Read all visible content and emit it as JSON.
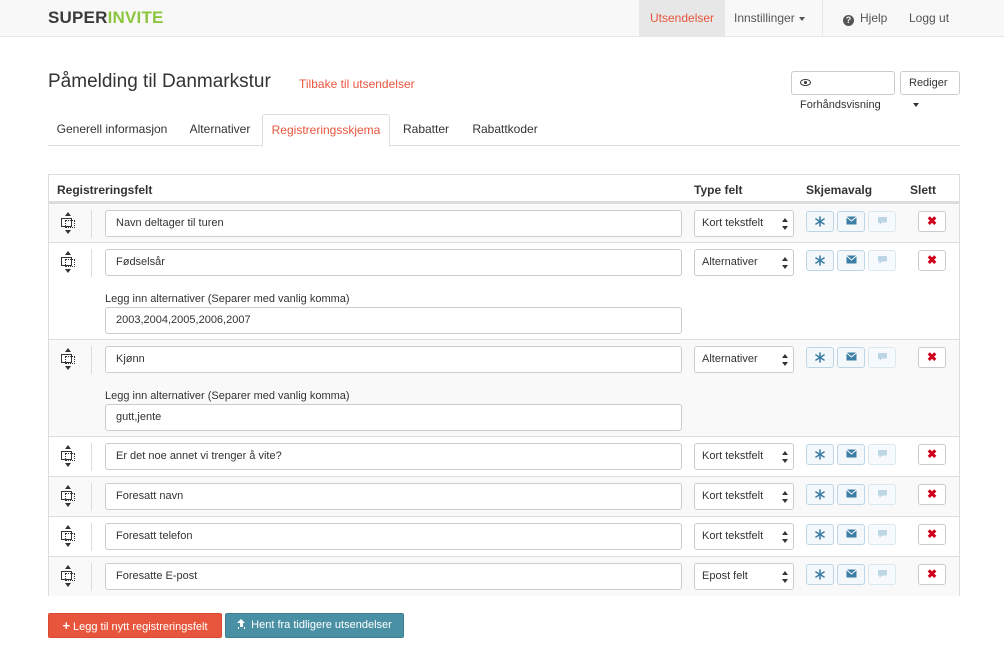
{
  "navbar": {
    "logo_part1": "SUPER",
    "logo_part2": "INVITE",
    "items": [
      {
        "label": "Utsendelser"
      },
      {
        "label": "Innstillinger"
      },
      {
        "label": "Hjelp"
      },
      {
        "label": "Logg ut"
      }
    ]
  },
  "header": {
    "title": "Påmelding til Danmarkstur",
    "back_link": "Tilbake til utsendelser",
    "preview_label": "Forhåndsvisning",
    "edit_label": "Rediger"
  },
  "tabs": [
    {
      "label": "Generell informasjon"
    },
    {
      "label": "Alternativer"
    },
    {
      "label": "Registreringsskjema"
    },
    {
      "label": "Rabatter"
    },
    {
      "label": "Rabattkoder"
    }
  ],
  "table": {
    "headers": {
      "field": "Registreringsfelt",
      "type": "Type felt",
      "options": "Skjemavalg",
      "delete": "Slett"
    },
    "alt_label": "Legg inn alternativer (Separer med vanlig komma)",
    "rows": [
      {
        "field": "Navn deltager til turen",
        "type": "Kort tekstfelt"
      },
      {
        "field": "Fødselsår",
        "type": "Alternativer",
        "alternatives": "2003,2004,2005,2006,2007"
      },
      {
        "field": "Kjønn",
        "type": "Alternativer",
        "alternatives": "gutt,jente"
      },
      {
        "field": "Er det noe annet vi trenger å vite?",
        "type": "Kort tekstfelt"
      },
      {
        "field": "Foresatt navn",
        "type": "Kort tekstfelt"
      },
      {
        "field": "Foresatt telefon",
        "type": "Kort tekstfelt"
      },
      {
        "field": "Foresatte E-post",
        "type": "Epost felt"
      }
    ],
    "delete_glyph": "✖"
  },
  "actions": {
    "add_label": "Legg til nytt registreringsfelt",
    "fetch_label": "Hent fra tidligere utsendelser"
  },
  "colors": {
    "accent": "#e8553d",
    "brand_green": "#8cc63f",
    "fetch_blue": "#4a90a4"
  }
}
